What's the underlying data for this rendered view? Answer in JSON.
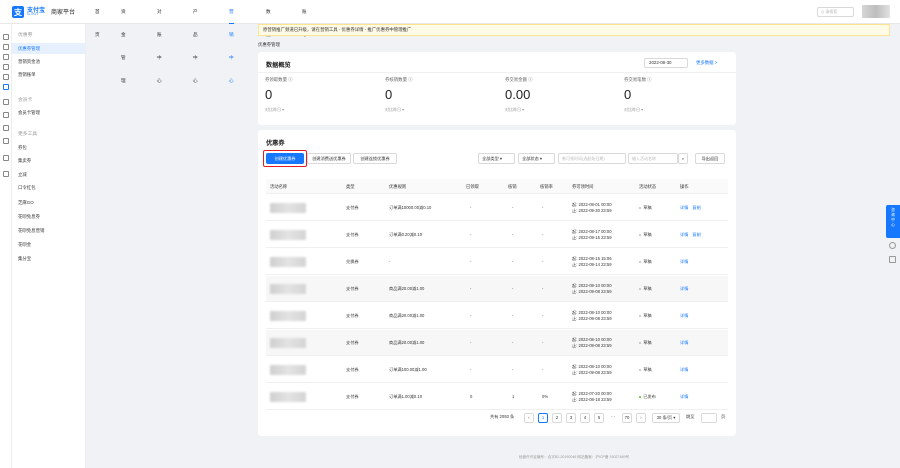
{
  "header": {
    "logo_mark": "支",
    "logo_text": "支付宝",
    "logo_sub": "ALIPAY",
    "app_name": "商家平台",
    "nav": [
      {
        "label": "首页",
        "active": false
      },
      {
        "label": "资金管理",
        "active": false
      },
      {
        "label": "对账中心",
        "active": false
      },
      {
        "label": "产品中心",
        "active": false
      },
      {
        "label": "营销中心",
        "active": true
      },
      {
        "label": "数据中心",
        "active": false
      },
      {
        "label": "账号中心",
        "active": false
      }
    ],
    "search_placeholder": "Q 请搜索"
  },
  "sidebar": {
    "groups": [
      {
        "title": "优惠券",
        "items": [
          {
            "label": "优惠券管理",
            "active": true
          },
          {
            "label": "营销资金池",
            "active": false
          },
          {
            "label": "营销账单",
            "active": false
          }
        ]
      },
      {
        "title": "会员卡",
        "items": [
          {
            "label": "会员卡管理",
            "active": false
          }
        ]
      },
      {
        "title": "更多工具",
        "items": [
          {
            "label": "券包",
            "active": false
          },
          {
            "label": "集卖券",
            "active": false
          },
          {
            "label": "立减",
            "active": false
          },
          {
            "label": "口令红包",
            "active": false
          },
          {
            "label": "芝麻GO",
            "active": false
          },
          {
            "label": "花呗免息券",
            "active": false
          },
          {
            "label": "花呗免息营销",
            "active": false
          },
          {
            "label": "花呗金",
            "active": false
          },
          {
            "label": "集分宝",
            "active": false
          }
        ]
      }
    ]
  },
  "notice": "原营销推广频道已升级，请在营销工具 - 优惠券详情 - 推广优惠券中管理推广",
  "breadcrumb": "优惠券管理",
  "overview": {
    "title": "数据概览",
    "date": "2022-08-30",
    "more_link": "更多数据 >",
    "stats": [
      {
        "label": "券领取数量 ⓘ",
        "value": "0",
        "compare": "对比昨日 ▾"
      },
      {
        "label": "券核销数量 ⓘ",
        "value": "0",
        "compare": "对比昨日 ▾"
      },
      {
        "label": "券交易金额 ⓘ",
        "value": "0.00",
        "compare": "对比昨日 ▾"
      },
      {
        "label": "券交易笔数 ⓘ",
        "value": "0",
        "compare": "对比昨日 ▾"
      }
    ]
  },
  "coupons": {
    "title": "优惠券",
    "buttons": {
      "create": "创建优惠券",
      "create_by_expense": "创建消费送优惠券",
      "create_auth": "创建连锁优惠券",
      "export": "导出返回"
    },
    "filters": {
      "type": "全部类型 ▾",
      "status": "全部状态 ▾",
      "code_placeholder": "券可领时间(选起始日期)",
      "name_placeholder": "输入活动名称"
    },
    "columns": [
      "活动名称",
      "类型",
      "优惠规则",
      "已领取",
      "核销",
      "核销率",
      "券可领时间",
      "活动状态",
      "操作"
    ],
    "rows": [
      {
        "type": "支付券",
        "rule": "订单满10000.00减0.10",
        "received": "-",
        "used": "-",
        "rate": "-",
        "start": "起: 2022-08-01 00:00",
        "end": "止: 2022-09-30 23:59",
        "status": "草稿",
        "on": false,
        "actions": [
          "详情",
          "复制"
        ]
      },
      {
        "type": "支付券",
        "rule": "订单满0.20减0.10",
        "received": "-",
        "used": "-",
        "rate": "-",
        "start": "起: 2022-08-17 00:00",
        "end": "止: 2022-09-15 23:59",
        "status": "草稿",
        "on": false,
        "actions": [
          "详情",
          "复制"
        ]
      },
      {
        "type": "兑换券",
        "rule": "-",
        "received": "-",
        "used": "-",
        "rate": "-",
        "start": "起: 2022-08-15 15:06",
        "end": "止: 2022-09-14 23:59",
        "status": "草稿",
        "on": false,
        "actions": [
          "详情"
        ]
      },
      {
        "type": "支付券",
        "rule": "商品满20.00减1.00",
        "received": "-",
        "used": "-",
        "rate": "-",
        "start": "起: 2022-08-10 00:00",
        "end": "止: 2022-09-08 23:59",
        "status": "草稿",
        "on": false,
        "actions": [
          "详情"
        ]
      },
      {
        "type": "支付券",
        "rule": "商品满20.00减1.00",
        "received": "-",
        "used": "-",
        "rate": "-",
        "start": "起: 2022-08-10 00:00",
        "end": "止: 2022-09-08 23:59",
        "status": "草稿",
        "on": false,
        "actions": [
          "详情"
        ]
      },
      {
        "type": "支付券",
        "rule": "商品满20.00减1.00",
        "received": "-",
        "used": "-",
        "rate": "-",
        "start": "起: 2022-08-10 00:00",
        "end": "止: 2022-09-08 23:59",
        "status": "草稿",
        "on": false,
        "actions": [
          "详情"
        ]
      },
      {
        "type": "支付券",
        "rule": "订单满100.00减1.00",
        "received": "-",
        "used": "-",
        "rate": "-",
        "start": "起: 2022-08-10 00:00",
        "end": "止: 2022-09-08 23:59",
        "status": "草稿",
        "on": false,
        "actions": [
          "详情"
        ]
      },
      {
        "type": "支付券",
        "rule": "订单满1.00减0.10",
        "received": "0",
        "used": "1",
        "rate": "0%",
        "start": "起: 2022-07-20 00:00",
        "end": "止: 2022-08-18 23:59",
        "status": "已发布",
        "on": true,
        "actions": [
          "详情"
        ]
      }
    ],
    "pagination": {
      "total": "共有 2093 条",
      "prev": "‹",
      "pages": [
        "1",
        "2",
        "3",
        "4",
        "5",
        "···",
        "70"
      ],
      "next": "›",
      "page_size": "30 条/页 ▾",
      "jump_label": "跳至",
      "jump_suffix": "页"
    }
  },
  "footer": "经营许可证编号：合字B2-20190046 网站备案：沪ICP备 15027489号",
  "float_tab": [
    "咨",
    "询",
    "中",
    "心"
  ]
}
